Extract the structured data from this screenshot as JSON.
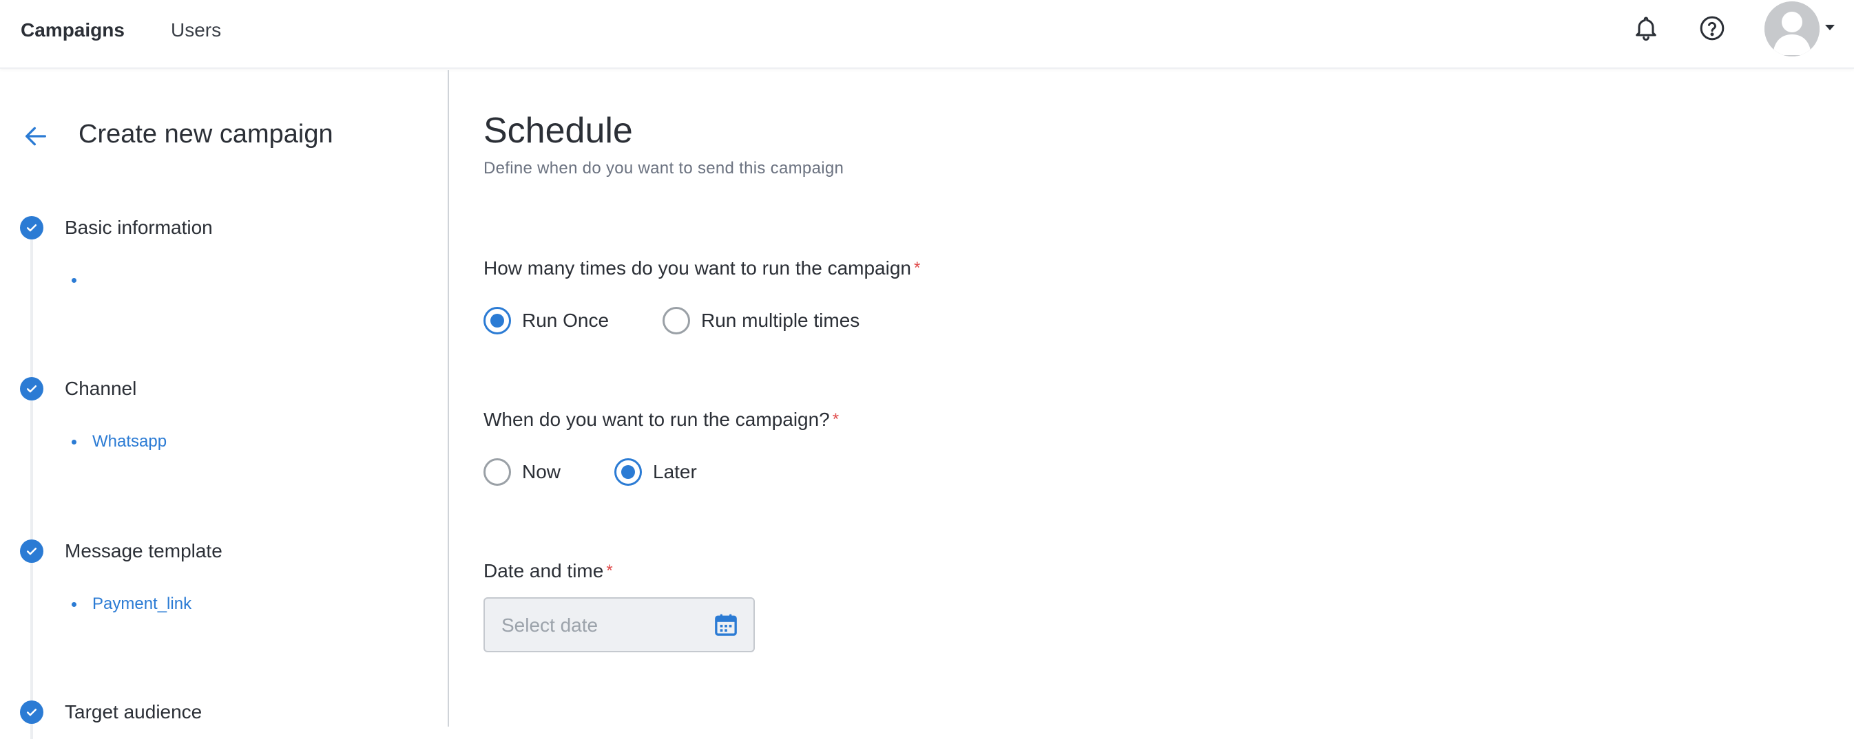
{
  "header": {
    "nav": [
      {
        "label": "Campaigns",
        "active": true
      },
      {
        "label": "Users",
        "active": false
      }
    ],
    "icons": [
      "bell-icon",
      "help-icon",
      "avatar",
      "chevron-down-icon"
    ]
  },
  "sidebar": {
    "title": "Create new campaign",
    "back_icon": "arrow-left-icon",
    "steps": [
      {
        "label": "Basic information",
        "completed": true,
        "sub": ""
      },
      {
        "label": "Channel",
        "completed": true,
        "sub": "Whatsapp"
      },
      {
        "label": "Message template",
        "completed": true,
        "sub": "Payment_link"
      },
      {
        "label": "Target audience",
        "completed": true,
        "sub": ""
      }
    ]
  },
  "main": {
    "title": "Schedule",
    "subtitle": "Define when do you want to send this campaign",
    "run_count": {
      "question": "How many times do you want to run the campaign",
      "required_mark": "*",
      "options": [
        {
          "label": "Run Once",
          "selected": true
        },
        {
          "label": "Run multiple times",
          "selected": false
        }
      ]
    },
    "run_when": {
      "question": "When do you want to run the campaign?",
      "required_mark": "*",
      "options": [
        {
          "label": "Now",
          "selected": false
        },
        {
          "label": "Later",
          "selected": true
        }
      ]
    },
    "datetime": {
      "label": "Date and time",
      "required_mark": "*",
      "placeholder": "Select date",
      "value": "",
      "icon": "calendar-icon"
    }
  },
  "colors": {
    "accent": "#2b7bd4",
    "required": "#e04b4b",
    "text": "#2b2f36",
    "muted": "#6b7280"
  }
}
